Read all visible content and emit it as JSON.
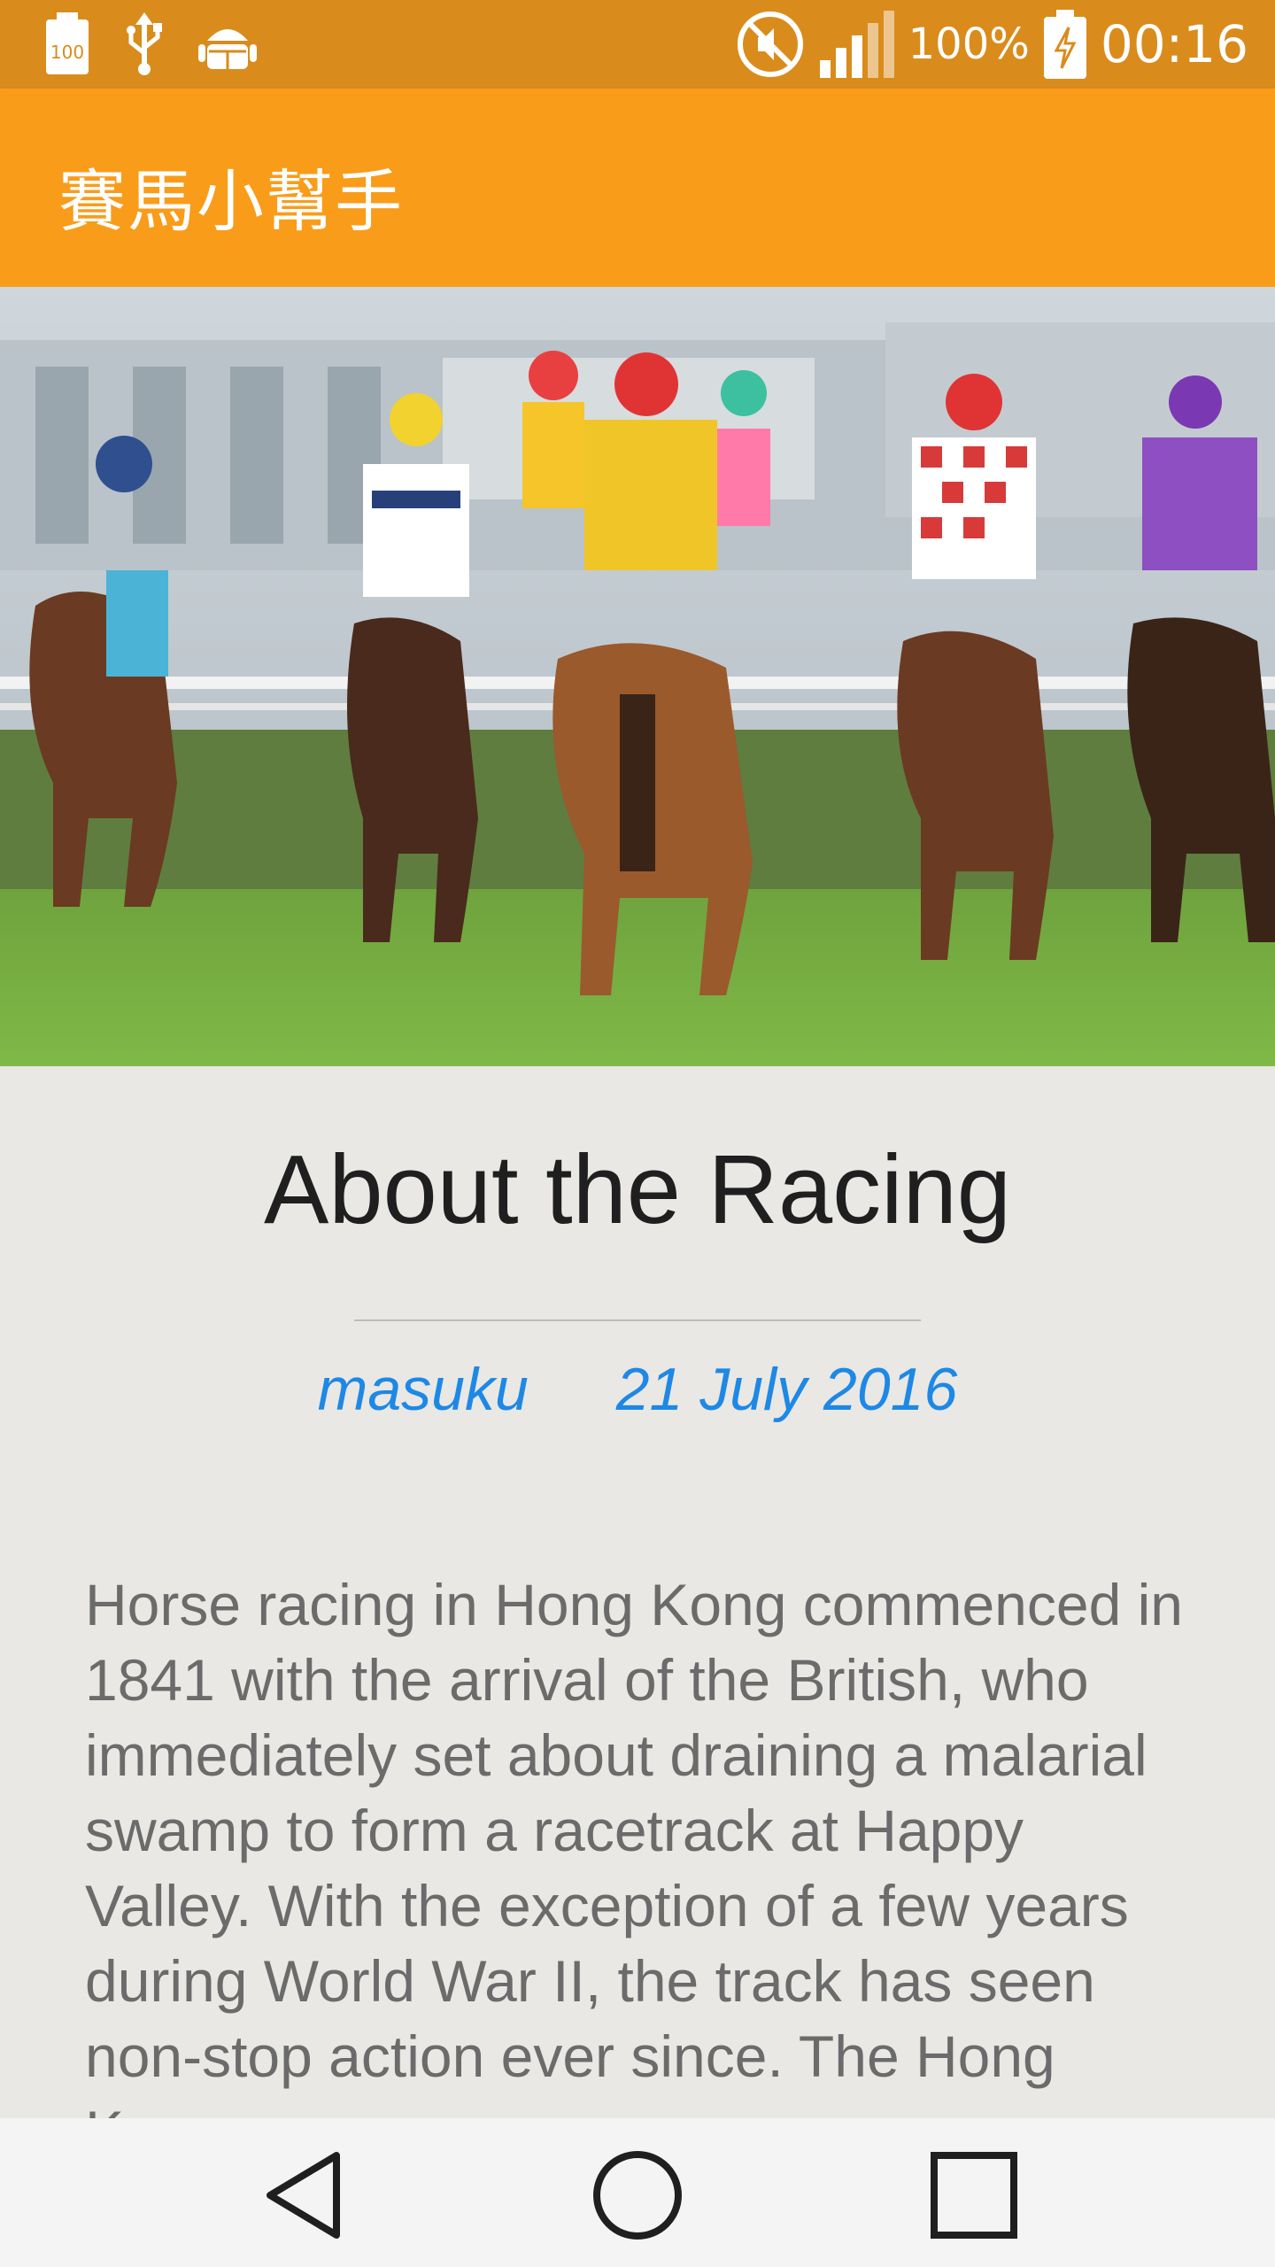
{
  "status_bar": {
    "battery_percent": "100%",
    "time": "00:16",
    "left_icons": [
      "battery-100-icon",
      "usb-icon",
      "android-debug-icon"
    ],
    "right_icons": [
      "mute-icon",
      "signal-icon",
      "battery-charging-icon"
    ]
  },
  "app_bar": {
    "title": "賽馬小幫手"
  },
  "hero": {
    "image": "horse-racing-photo"
  },
  "article": {
    "title": "About the Racing",
    "author": "masuku",
    "date": "21 July 2016",
    "body": "Horse racing in Hong Kong commenced in 1841 with the arrival of the British, who immediately set about draining a malarial swamp to form a racetrack at Happy Valley. With the exception of a few years during World War II, the track has seen non-stop action ever since. The Hong Kong"
  },
  "nav_bar": {
    "buttons": [
      "back",
      "home",
      "recents"
    ]
  },
  "colors": {
    "status_bar": "#d98c1c",
    "app_bar": "#f99c1a",
    "accent": "#1e88e5",
    "background": "#e9e8e4"
  }
}
